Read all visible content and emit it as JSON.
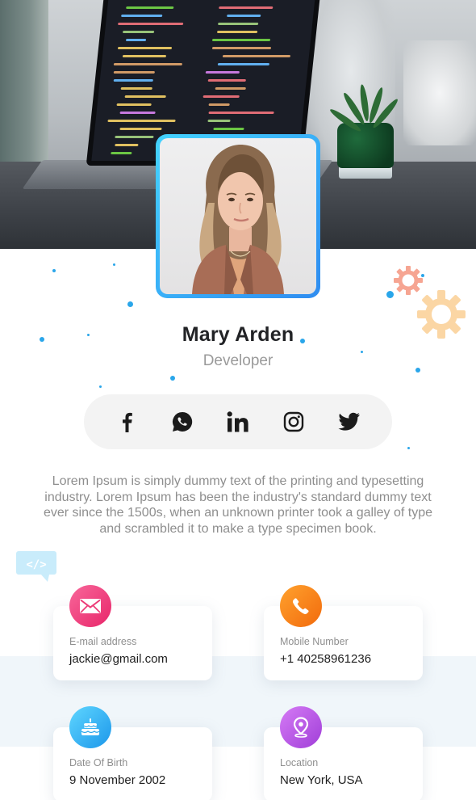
{
  "profile": {
    "name": "Mary Arden",
    "role": "Developer"
  },
  "social": [
    {
      "network": "facebook",
      "icon": "facebook-icon"
    },
    {
      "network": "whatsapp",
      "icon": "whatsapp-icon"
    },
    {
      "network": "linkedin",
      "icon": "linkedin-icon"
    },
    {
      "network": "instagram",
      "icon": "instagram-icon"
    },
    {
      "network": "twitter",
      "icon": "twitter-icon"
    }
  ],
  "bio": "Lorem Ipsum is simply dummy text of the printing and typesetting industry. Lorem Ipsum has been the industry's standard dummy text ever since the 1500s, when an unknown printer took a galley of type and scrambled it to make a type specimen book.",
  "contacts": {
    "email": {
      "label": "E-mail address",
      "value": "jackie@gmail.com",
      "icon": "mail-icon",
      "color": "#f0437c"
    },
    "mobile": {
      "label": "Mobile Number",
      "value": "+1 40258961236",
      "icon": "phone-icon",
      "color": "#f77b13"
    },
    "birth": {
      "label": "Date Of Birth",
      "value": "9 November 2002",
      "icon": "cake-icon",
      "color": "#2fb4ef"
    },
    "location": {
      "label": "Location",
      "value": "New York, USA",
      "icon": "location-pin-icon",
      "color": "#b753e6"
    }
  },
  "colors": {
    "accent": "#2aa6ea",
    "avatar_frame": "#3bb5f6",
    "band": "#f0f6fa"
  }
}
